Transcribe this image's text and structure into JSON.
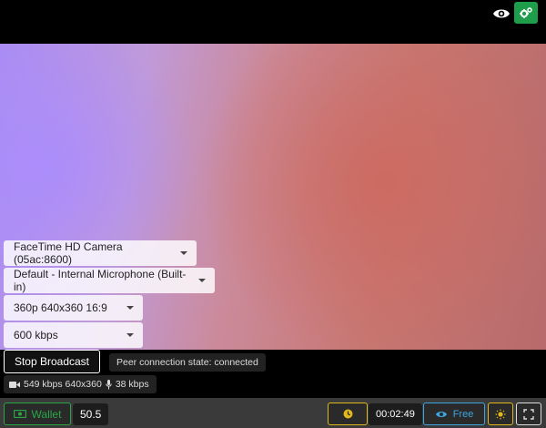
{
  "top": {
    "eye_icon": "eye-icon",
    "settings_icon": "gears-icon",
    "settings_color": "#1e9e4a"
  },
  "controls": {
    "camera": "FaceTime HD Camera (05ac:8600)",
    "microphone": "Default - Internal Microphone (Built-in)",
    "resolution": "360p 640x360 16:9",
    "bitrate": "600 kbps"
  },
  "broadcast": {
    "stop_label": "Stop Broadcast",
    "peer_state": "Peer connection state: connected",
    "video_stats": "549 kbps 640x360",
    "audio_stats": "38 kbps"
  },
  "bottom": {
    "wallet_label": "Wallet",
    "balance": "50.5",
    "timer": "00:02:49",
    "free_label": "Free",
    "colors": {
      "wallet": "#28a745",
      "clock": "#e0b81c",
      "free": "#3ba6e0"
    }
  }
}
